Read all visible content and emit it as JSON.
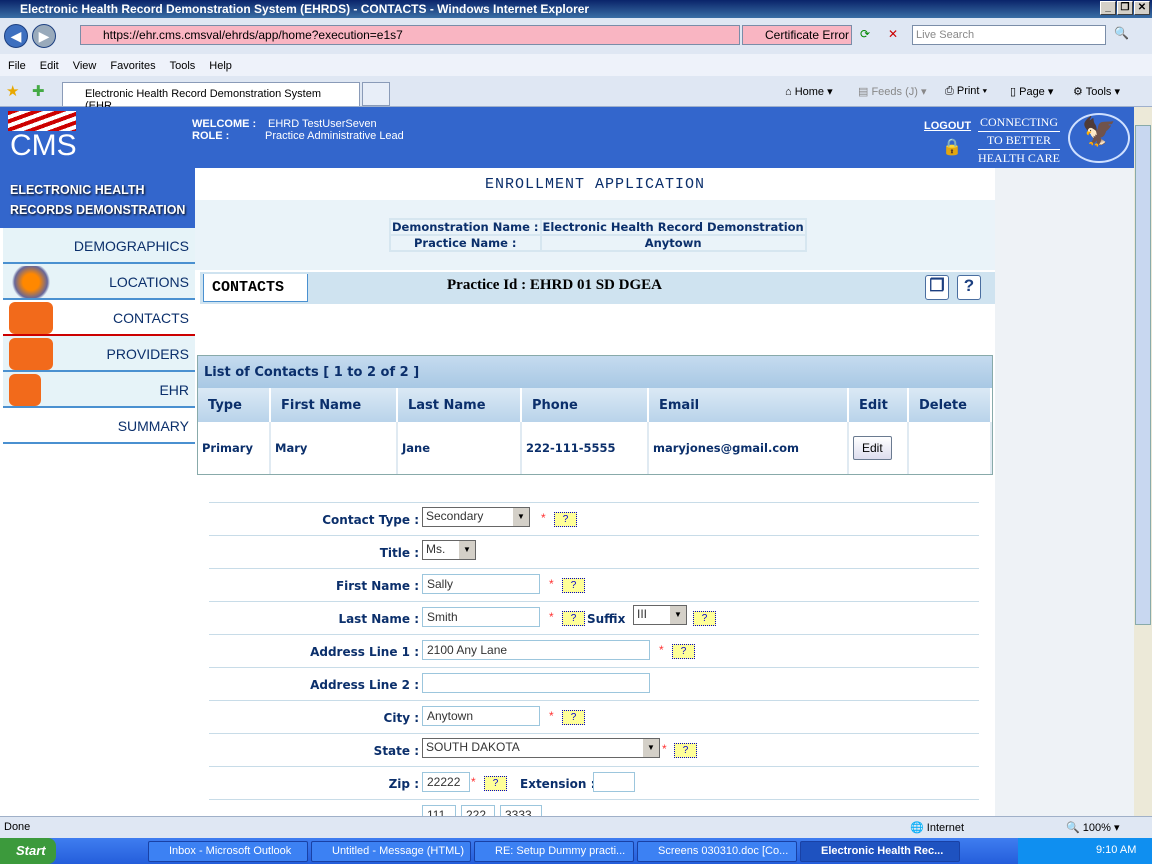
{
  "browser": {
    "title": "Electronic Health Record Demonstration System (EHRDS) - CONTACTS - Windows Internet Explorer",
    "url": "https://ehr.cms.cmsval/ehrds/app/home?execution=e1s7",
    "cert_error": "Certificate Error",
    "search_placeholder": "Live Search",
    "menu": [
      "File",
      "Edit",
      "View",
      "Favorites",
      "Tools",
      "Help"
    ],
    "tab": "Electronic Health Record Demonstration System (EHR...",
    "tools": {
      "home": "Home",
      "feeds": "Feeds (J)",
      "print": "Print",
      "page": "Page",
      "tools": "Tools"
    }
  },
  "header": {
    "logo": "CMS",
    "welcome_label": "WELCOME :",
    "welcome_value": "EHRD TestUserSeven",
    "role_label": "ROLE :",
    "role_value": "Practice Administrative Lead",
    "logout": "LOGOUT",
    "tagline": [
      "CONNECTING",
      "TO BETTER",
      "HEALTH CARE"
    ]
  },
  "sidebar": {
    "title": "ELECTRONIC HEALTH RECORDS DEMONSTRATION",
    "items": [
      {
        "label": "DEMOGRAPHICS"
      },
      {
        "label": "LOCATIONS"
      },
      {
        "label": "CONTACTS"
      },
      {
        "label": "PROVIDERS"
      },
      {
        "label": "EHR"
      },
      {
        "label": "SUMMARY"
      }
    ]
  },
  "main": {
    "title": "ENROLLMENT APPLICATION",
    "demo_name_label": "Demonstration Name :",
    "demo_name": "Electronic Health Record Demonstration",
    "practice_name_label": "Practice Name :",
    "practice_name": "Anytown",
    "tab": "CONTACTS",
    "practice_id": "Practice Id : EHRD 01 SD DGEA"
  },
  "contacts": {
    "header": "List of Contacts [ 1 to 2 of 2 ]",
    "columns": [
      "Type",
      "First Name",
      "Last Name",
      "Phone",
      "Email",
      "Edit",
      "Delete"
    ],
    "rows": [
      {
        "type": "Primary",
        "first": "Mary",
        "last": "Jane",
        "phone": "222-111-5555",
        "email": "maryjones@gmail.com",
        "edit": "Edit"
      }
    ]
  },
  "form": {
    "contact_type_label": "Contact Type :",
    "contact_type": "Secondary",
    "title_label": "Title :",
    "title": "Ms.",
    "first_name_label": "First Name :",
    "first_name": "Sally",
    "last_name_label": "Last Name :",
    "last_name": "Smith",
    "suffix_label": "Suffix",
    "suffix": "III",
    "address1_label": "Address Line 1 :",
    "address1": "2100 Any Lane",
    "address2_label": "Address Line 2 :",
    "address2": "",
    "city_label": "City :",
    "city": "Anytown",
    "state_label": "State :",
    "state": "SOUTH DAKOTA",
    "zip_label": "Zip :",
    "zip": "22222",
    "extension_label": "Extension :",
    "extension": "",
    "phone": [
      "111",
      "222",
      "3333"
    ],
    "required": "*",
    "help": "?"
  },
  "status": {
    "text": "Done",
    "zone": "Internet",
    "zoom": "100%"
  },
  "taskbar": {
    "start": "Start",
    "tasks": [
      "Inbox - Microsoft Outlook",
      "Untitled - Message (HTML)",
      "RE: Setup Dummy practi...",
      "Screens 030310.doc [Co...",
      "Electronic Health Rec..."
    ],
    "time": "9:10 AM"
  }
}
